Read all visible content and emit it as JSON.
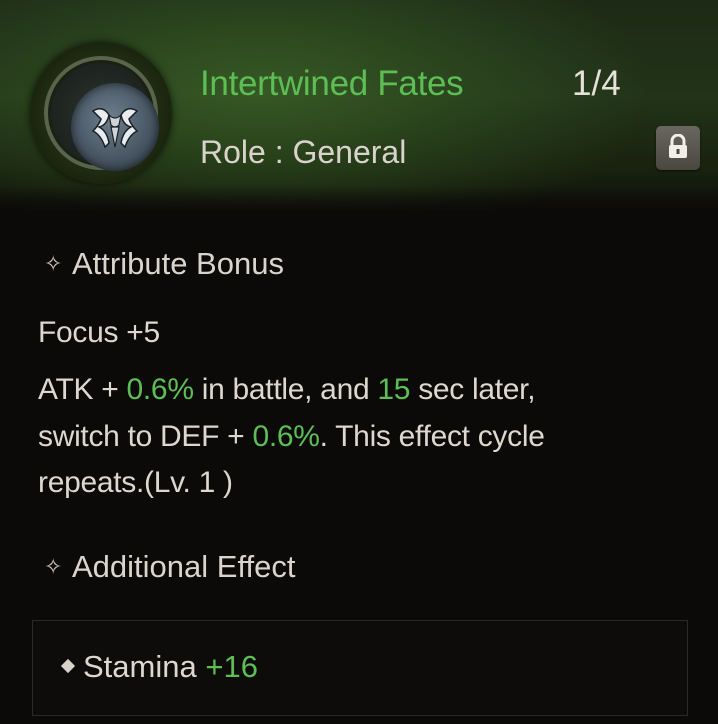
{
  "header": {
    "title": "Intertwined Fates",
    "progress": "1/4",
    "role": "Role : General",
    "emblem_icon": "intertwined-crest-icon",
    "lock_icon": "lock-icon"
  },
  "attribute_bonus": {
    "heading": "Attribute Bonus",
    "focus": "Focus +5",
    "line2": {
      "a": "ATK + ",
      "b": "0.6%",
      "c": " in battle, and ",
      "d": "15",
      "e": " sec later,"
    },
    "line3": {
      "a": "switch to DEF + ",
      "b": "0.6%",
      "c": ". This effect cycle"
    },
    "line4": "repeats.(Lv. 1 )"
  },
  "additional_effect": {
    "heading": "Additional Effect",
    "stat_name": "Stamina",
    "stat_value": "+16"
  },
  "colors": {
    "accent_green": "#5dbe55",
    "text": "#ddd8cf",
    "background": "#0c0a08"
  }
}
